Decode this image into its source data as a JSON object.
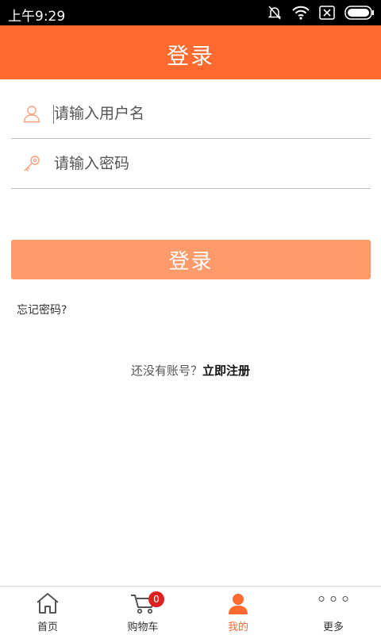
{
  "status_bar": {
    "time": "上午9:29",
    "icons": [
      "silent-bell-icon",
      "wifi-icon",
      "no-sim-icon",
      "battery-icon"
    ]
  },
  "header": {
    "title": "登录"
  },
  "login_form": {
    "username": {
      "placeholder": "请输入用户名",
      "value": "",
      "icon": "user-icon"
    },
    "password": {
      "placeholder": "请输入密码",
      "value": "",
      "icon": "key-icon"
    },
    "submit_label": "登录",
    "forgot_label": "忘记密码?",
    "register_prompt": "还没有账号？",
    "register_label": "立即注册"
  },
  "bottom_nav": {
    "items": [
      {
        "label": "首页",
        "icon": "home-icon",
        "active": false
      },
      {
        "label": "购物车",
        "icon": "cart-icon",
        "active": false,
        "badge": "0"
      },
      {
        "label": "我的",
        "icon": "person-icon",
        "active": true
      },
      {
        "label": "更多",
        "icon": "more-icon",
        "active": false
      }
    ]
  },
  "colors": {
    "accent": "#ff6a2e",
    "button": "#ff9b6b",
    "badge": "#e02020"
  }
}
